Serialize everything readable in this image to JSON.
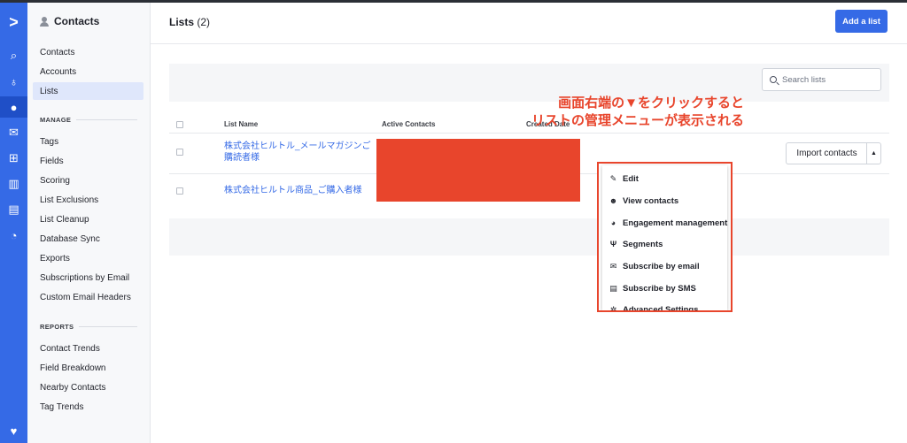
{
  "rail": {
    "icons": [
      "logo-chevron-icon",
      "search-icon",
      "lightbulb-icon",
      "contacts-icon",
      "mail-icon",
      "automation-icon",
      "deals-icon",
      "website-icon",
      "reports-icon",
      "heart-icon"
    ]
  },
  "sidebar": {
    "title": "Contacts",
    "items_top": [
      "Contacts",
      "Accounts",
      "Lists"
    ],
    "manage_heading": "MANAGE",
    "manage_items": [
      "Tags",
      "Fields",
      "Scoring",
      "List Exclusions",
      "List Cleanup",
      "Database Sync",
      "Exports",
      "Subscriptions by Email",
      "Custom Email Headers"
    ],
    "reports_heading": "REPORTS",
    "reports_items": [
      "Contact Trends",
      "Field Breakdown",
      "Nearby Contacts",
      "Tag Trends"
    ]
  },
  "header": {
    "title": "Lists",
    "count": "(2)",
    "add_button": "Add a list"
  },
  "search": {
    "placeholder": "Search lists"
  },
  "table": {
    "columns": [
      "List Name",
      "Active Contacts",
      "Created Date"
    ],
    "rows": [
      {
        "name_line1": "株式会社ヒルトル_メールマガジンご",
        "name_line2": "購読者様"
      },
      {
        "name_line1": "株式会社ヒルトル商品_ご購入者様",
        "name_line2": ""
      }
    ]
  },
  "row_actions": {
    "import_button": "Import contacts",
    "caret": "▲"
  },
  "annotation": {
    "line1": "画面右端の▼をクリックすると",
    "line2": "リストの管理メニューが表示される"
  },
  "dropdown": {
    "items": [
      {
        "label": "Edit",
        "icon": "pencil-icon"
      },
      {
        "label": "View contacts",
        "icon": "people-icon"
      },
      {
        "label": "Engagement management",
        "icon": "pie-icon"
      },
      {
        "label": "Segments",
        "icon": "fork-icon"
      },
      {
        "label": "Subscribe by email",
        "icon": "envelope-icon"
      },
      {
        "label": "Subscribe by SMS",
        "icon": "sms-icon"
      },
      {
        "label": "Advanced Settings",
        "icon": "gear-icon"
      }
    ]
  },
  "colors": {
    "brand": "#356ae6",
    "annotation": "#e8452c"
  }
}
